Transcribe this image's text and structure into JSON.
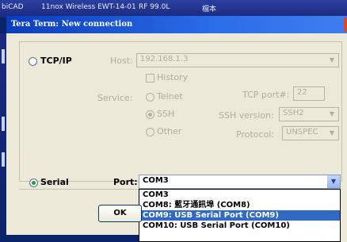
{
  "taskbar": {
    "items": [
      "biCAD",
      "11nox Wireless EWT-14-01",
      "RF 99.0L",
      "檔本"
    ]
  },
  "window": {
    "title": "Tera Term: New connection"
  },
  "tcpip": {
    "label": "TCP/IP",
    "host_label": "Host:",
    "host_value": "192.168.1.3",
    "history_label": "History",
    "service_label": "Service:",
    "telnet_label": "Telnet",
    "ssh_label": "SSH",
    "other_label": "Other",
    "tcp_port_label": "TCP port#:",
    "tcp_port_value": "22",
    "ssh_version_label": "SSH version:",
    "ssh_version_value": "SSH2",
    "protocol_label": "Protocol:",
    "protocol_value": "UNSPEC"
  },
  "serial": {
    "label": "Serial",
    "port_label": "Port:",
    "port_value": "COM3",
    "options": [
      "COM3",
      "COM8: 藍牙通訊埠 (COM8)",
      "COM9: USB Serial Port (COM9)",
      "COM10: USB Serial Port (COM10)"
    ],
    "selected_index": 2
  },
  "buttons": {
    "ok": "OK"
  },
  "colors": {
    "title_bar": "#2b6ce8",
    "selection": "#316ac5",
    "radio_check": "#21a121"
  }
}
